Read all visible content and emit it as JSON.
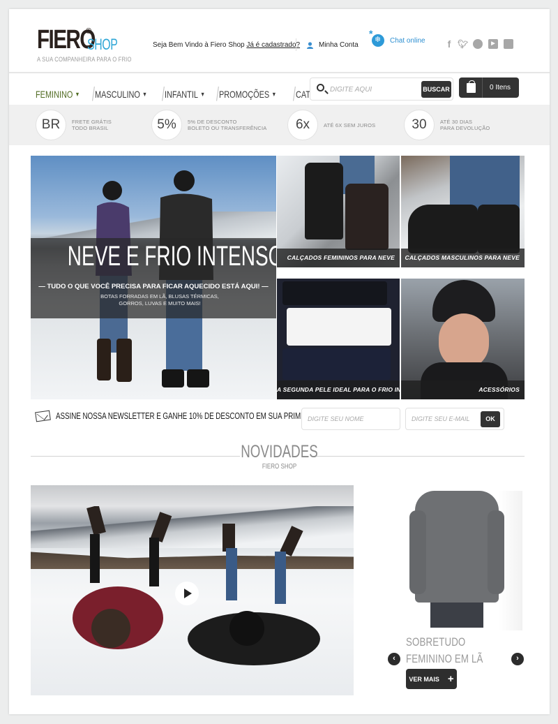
{
  "brand": {
    "name": "FIERO",
    "registered": "®",
    "shop": "SHOP",
    "tagline": "A SUA COMPANHEIRA PARA O FRIO"
  },
  "topbar": {
    "welcome_text": "Seja Bem Vindo à Fiero Shop",
    "register_link": "Já é cadastrado?",
    "account_label": "Minha Conta",
    "chat_label": "Chat online",
    "social_icons": [
      "facebook-icon",
      "twitter-icon",
      "chat-icon",
      "youtube-icon",
      "instagram-icon"
    ]
  },
  "nav": {
    "items": [
      {
        "label": "FEMININO",
        "dropdown": true
      },
      {
        "label": "MASCULINO",
        "dropdown": true
      },
      {
        "label": "INFANTIL",
        "dropdown": true
      },
      {
        "label": "PROMOÇÕES",
        "dropdown": true
      },
      {
        "label": "CATÁLOGO",
        "dropdown": false
      }
    ]
  },
  "search": {
    "placeholder": "DIGITE AQUI",
    "button_label": "BUSCAR"
  },
  "cart": {
    "label": "0 Itens"
  },
  "benefits": [
    {
      "badge": "BR",
      "text": "FRETE GRÁTIS\nTODO BRASIL"
    },
    {
      "badge": "5%",
      "text": "5% DE DESCONTO\nBOLETO OU TRANSFERÊNCIA"
    },
    {
      "badge": "6x",
      "text": "ATÉ 6X SEM JUROS"
    },
    {
      "badge": "30",
      "text": "ATÉ 30 DIAS\nPARA DEVOLUÇÃO"
    }
  ],
  "hero": {
    "headline": "NEVE E FRIO INTENSO?",
    "subtitle": "— TUDO O QUE VOCÊ PRECISA PARA FICAR AQUECIDO ESTÁ AQUI! —",
    "description": "BOTAS FORRADAS EM LÃ, BLUSAS TÉRMICAS, GORROS, LUVAS E MUITO MAIS!"
  },
  "tiles": [
    {
      "caption": "CALÇADOS FEMININOS PARA NEVE"
    },
    {
      "caption": "CALÇADOS MASCULINOS PARA NEVE"
    },
    {
      "caption": "A SEGUNDA PELE IDEAL PARA O FRIO INTENSO"
    },
    {
      "caption": "ACESSÓRIOS"
    }
  ],
  "newsletter": {
    "label": "ASSINE NOSSA NEWSLETTER E GANHE 10% DE DESCONTO EM SUA PRIMEIRA COMPRA",
    "name_placeholder": "DIGITE SEU NOME",
    "email_placeholder": "DIGITE SEU E-MAIL",
    "submit_label": "OK"
  },
  "novidades": {
    "title": "NOVIDADES",
    "subtitle": "FIERO SHOP"
  },
  "product": {
    "name": "SOBRETUDO FEMININO EM LÃ TWEED",
    "cta_label": "VER MAIS",
    "cta_icon": "+"
  }
}
